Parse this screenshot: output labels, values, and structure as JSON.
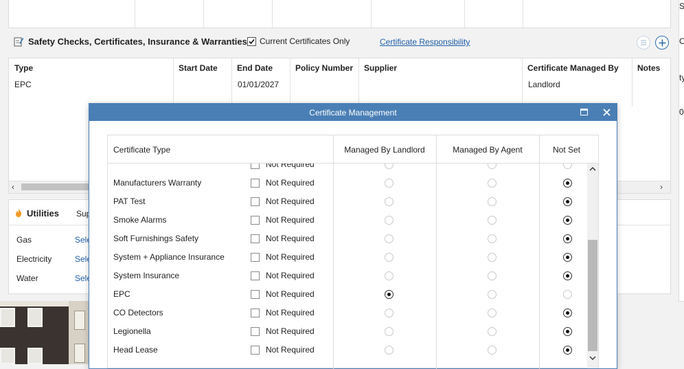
{
  "background": {
    "safety_section": {
      "title": "Safety Checks, Certificates, Insurance & Warranties",
      "current_only_label": "Current Certificates Only",
      "current_only_checked": true,
      "responsibility_link": "Certificate Responsibility",
      "columns": [
        "Type",
        "Start Date",
        "End Date",
        "Policy Number",
        "Supplier",
        "Certificate Managed By",
        "Notes"
      ],
      "row": {
        "type": "EPC",
        "start": "",
        "end": "01/01/2027",
        "policy": "",
        "supplier": "",
        "managed_by": "Landlord",
        "notes": ""
      }
    },
    "utilities": {
      "title": "Utilities",
      "supplier_header": "Sup",
      "rows": [
        {
          "label": "Gas",
          "value": "Sele"
        },
        {
          "label": "Electricity",
          "value": "Sele"
        },
        {
          "label": "Water",
          "value": "Sele"
        }
      ]
    },
    "right_edge_fragments": [
      "St",
      "Ci",
      "ty",
      "0"
    ]
  },
  "dialog": {
    "title": "Certificate Management",
    "columns": {
      "type": "Certificate Type",
      "landlord": "Managed By Landlord",
      "agent": "Managed By Agent",
      "not_set": "Not Set"
    },
    "partial_row_label": "Not Required",
    "rows": [
      {
        "name": "Manufacturers Warranty",
        "not_required": "Not Required",
        "selection": "not_set"
      },
      {
        "name": "PAT Test",
        "not_required": "Not Required",
        "selection": "not_set"
      },
      {
        "name": "Smoke Alarms",
        "not_required": "Not Required",
        "selection": "not_set"
      },
      {
        "name": "Soft Furnishings Safety",
        "not_required": "Not Required",
        "selection": "not_set"
      },
      {
        "name": "System + Appliance Insurance",
        "not_required": "Not Required",
        "selection": "not_set"
      },
      {
        "name": "System Insurance",
        "not_required": "Not Required",
        "selection": "not_set"
      },
      {
        "name": "EPC",
        "not_required": "Not Required",
        "selection": "landlord"
      },
      {
        "name": "CO Detectors",
        "not_required": "Not Required",
        "selection": "not_set"
      },
      {
        "name": "Legionella",
        "not_required": "Not Required",
        "selection": "not_set"
      },
      {
        "name": "Head Lease",
        "not_required": "Not Required",
        "selection": "not_set"
      }
    ],
    "scroll_position": 0.55
  },
  "colors": {
    "dialog_title_bar": "#4a7fb5",
    "link": "#1f5fa8",
    "scroll_thumb": "#b9b9b9"
  }
}
